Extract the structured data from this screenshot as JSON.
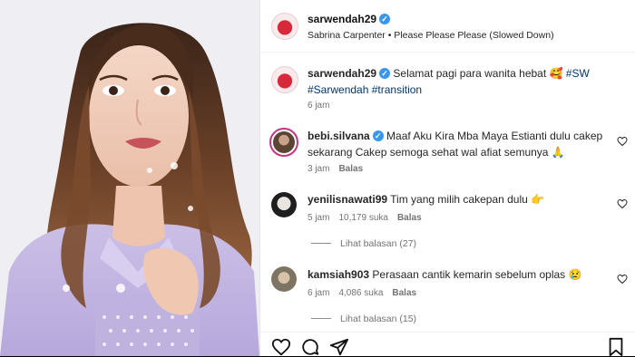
{
  "post": {
    "author": "sarwendah29",
    "audio": "Sabrina Carpenter • Please Please Please (Slowed Down)"
  },
  "caption": {
    "username": "sarwendah29",
    "text": "Selamat pagi para wanita hebat 🥰 ",
    "hashtags": "#SW #Sarwendah #transition",
    "time": "6 jam"
  },
  "comments": [
    {
      "username": "bebi.silvana",
      "text": "Maaf Aku Kira Mba Maya Estianti dulu cakep sekarang Cakep semoga sehat wal afiat semunya 🙏",
      "time": "3 jam",
      "reply": "Balas"
    },
    {
      "username": "yenilisnawati99",
      "text": "Tim yang milih cakepan dulu 👉",
      "time": "5 jam",
      "likes": "10,179 suka",
      "reply": "Balas",
      "view_replies": "Lihat balasan (27)"
    },
    {
      "username": "kamsiah903",
      "text": "Perasaan cantik kemarin sebelum oplas 😢",
      "time": "6 jam",
      "likes": "4,086 suka",
      "reply": "Balas",
      "view_replies": "Lihat balasan (15)"
    }
  ],
  "icons": {
    "verified": "verified-badge-icon",
    "like": "heart-icon",
    "comment": "comment-icon",
    "share": "send-icon",
    "save": "bookmark-icon"
  },
  "colors": {
    "verified": "#3897f0",
    "hashtag": "#00376b",
    "muted": "#737373",
    "story_ring": "#c13584"
  }
}
